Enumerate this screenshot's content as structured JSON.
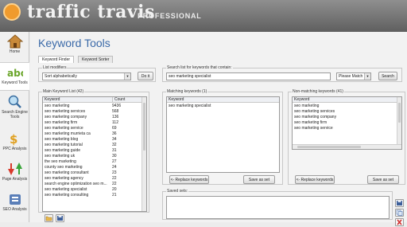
{
  "app": {
    "brand": "traffic travis",
    "edition": "PROFESSIONAL"
  },
  "sidebar": {
    "items": [
      {
        "label": "Home",
        "icon": "home-icon"
      },
      {
        "label": "Keyword Tools",
        "icon": "abc-icon"
      },
      {
        "label": "Search Engine Tools",
        "icon": "magnifier-icon"
      },
      {
        "label": "PPC Analysis",
        "icon": "dollar-icon"
      },
      {
        "label": "Page Analysis",
        "icon": "arrows-icon"
      },
      {
        "label": "SEO Analysis",
        "icon": "seo-icon"
      }
    ]
  },
  "page": {
    "title": "Keyword Tools"
  },
  "tabs": [
    {
      "label": "Keyword Finder"
    },
    {
      "label": "Keyword Sorter"
    }
  ],
  "list_modifiers": {
    "legend": "List modifiers",
    "selected": "Sort alphabetically",
    "button": "Do it"
  },
  "search": {
    "legend": "Search list for keywords that contain:",
    "value": "seo marketing specialist",
    "match": "Please Match",
    "button": "Search"
  },
  "main_list": {
    "legend": "Main Keyword List (42)",
    "col_keyword": "Keyword",
    "col_count": "Count",
    "rows": [
      {
        "k": "seo marketing",
        "c": "9436"
      },
      {
        "k": "seo marketing services",
        "c": "568"
      },
      {
        "k": "seo marketing company",
        "c": "136"
      },
      {
        "k": "seo marketing firm",
        "c": "112"
      },
      {
        "k": "seo marketing service",
        "c": "69"
      },
      {
        "k": "seo marketing murrieta ca",
        "c": "36"
      },
      {
        "k": "seo marketing blog",
        "c": "34"
      },
      {
        "k": "seo marketing tutorial",
        "c": "32"
      },
      {
        "k": "seo marketing guide",
        "c": "31"
      },
      {
        "k": "seo marketing uk",
        "c": "30"
      },
      {
        "k": "the seo marketing",
        "c": "27"
      },
      {
        "k": "county seo marketing",
        "c": "24"
      },
      {
        "k": "seo marketing consultant",
        "c": "23"
      },
      {
        "k": "seo marketing agency",
        "c": "22"
      },
      {
        "k": "search engine optimization seo m...",
        "c": "22"
      },
      {
        "k": "seo marketing specialist",
        "c": "20"
      },
      {
        "k": "seo marketing consulting",
        "c": "21"
      }
    ]
  },
  "matching": {
    "legend": "Matching keywords (1)",
    "col": "Keyword",
    "rows": [
      "seo marketing specialist"
    ],
    "replace": "<- Replace keywords",
    "save": "Save as set"
  },
  "nonmatching": {
    "legend": "Non-matching keywords (41)",
    "col": "Keyword",
    "rows": [
      "seo marketing",
      "seo marketing services",
      "seo marketing company",
      "seo marketing firm",
      "seo marketing service"
    ],
    "replace": "<- Replace keywords",
    "save": "Save as set"
  },
  "saved_sets": {
    "legend": "Saved sets:"
  },
  "colors": {
    "accent": "#3a69a8",
    "header": "#6f6f6f",
    "logo_orange": "#f09b2d"
  }
}
